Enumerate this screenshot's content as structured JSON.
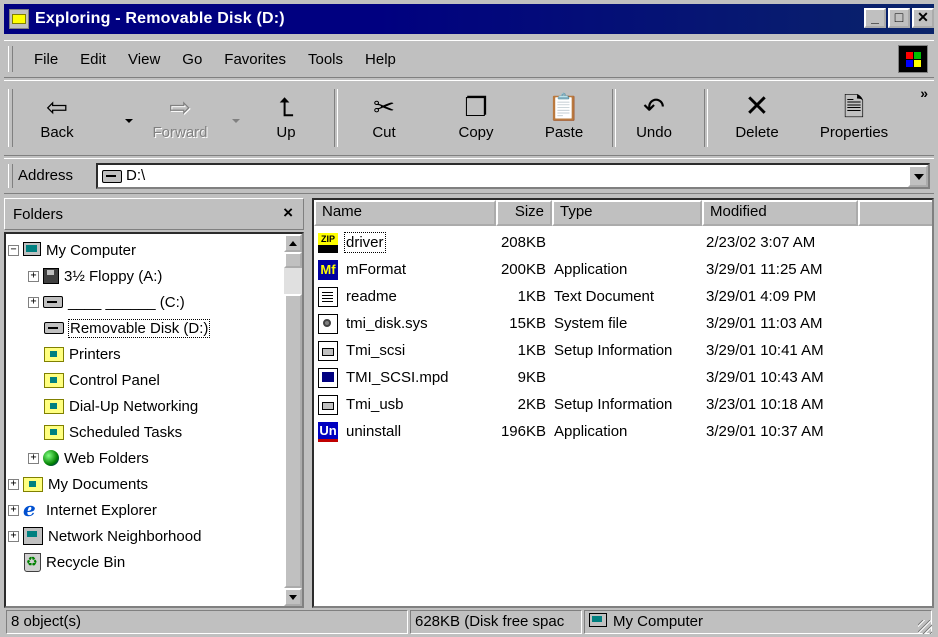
{
  "window": {
    "title": "Exploring - Removable Disk (D:)",
    "buttons": {
      "minimize": "_",
      "maximize": "□",
      "close": "✕"
    }
  },
  "menubar": {
    "items": [
      {
        "label": "File"
      },
      {
        "label": "Edit"
      },
      {
        "label": "View"
      },
      {
        "label": "Go"
      },
      {
        "label": "Favorites"
      },
      {
        "label": "Tools"
      },
      {
        "label": "Help"
      }
    ]
  },
  "toolbar": {
    "back": {
      "label": "Back",
      "icon": "back-arrow-icon"
    },
    "forward": {
      "label": "Forward",
      "icon": "forward-arrow-icon",
      "disabled": true
    },
    "up": {
      "label": "Up",
      "icon": "up-folder-icon"
    },
    "cut": {
      "label": "Cut",
      "icon": "scissors-icon"
    },
    "copy": {
      "label": "Copy",
      "icon": "copy-icon"
    },
    "paste": {
      "label": "Paste",
      "icon": "paste-icon"
    },
    "undo": {
      "label": "Undo",
      "icon": "undo-icon"
    },
    "delete": {
      "label": "Delete",
      "icon": "delete-x-icon"
    },
    "properties": {
      "label": "Properties",
      "icon": "properties-icon"
    },
    "more": "»"
  },
  "address": {
    "label": "Address",
    "value": "D:\\"
  },
  "folders_pane": {
    "title": "Folders",
    "close": "×",
    "tree": [
      {
        "label": "My Computer",
        "expander": "−",
        "icon": "computer-icon"
      },
      {
        "label": "3½ Floppy (A:)",
        "expander": "+",
        "icon": "floppy-icon"
      },
      {
        "label": "____ ______ (C:)",
        "expander": "+",
        "icon": "drive-icon"
      },
      {
        "label": "Removable Disk (D:)",
        "expander": "",
        "icon": "drive-icon",
        "selected": true
      },
      {
        "label": "Printers",
        "expander": "",
        "icon": "printers-folder-icon"
      },
      {
        "label": "Control Panel",
        "expander": "",
        "icon": "control-panel-icon"
      },
      {
        "label": "Dial-Up Networking",
        "expander": "",
        "icon": "dialup-folder-icon"
      },
      {
        "label": "Scheduled Tasks",
        "expander": "",
        "icon": "scheduled-tasks-icon"
      },
      {
        "label": "Web Folders",
        "expander": "+",
        "icon": "web-folders-icon"
      },
      {
        "label": "My Documents",
        "expander": "+",
        "icon": "my-documents-icon"
      },
      {
        "label": "Internet Explorer",
        "expander": "+",
        "icon": "internet-explorer-icon"
      },
      {
        "label": "Network Neighborhood",
        "expander": "+",
        "icon": "network-icon"
      },
      {
        "label": "Recycle Bin",
        "expander": "",
        "icon": "recycle-bin-icon"
      }
    ]
  },
  "file_list": {
    "columns": {
      "name": "Name",
      "size": "Size",
      "type": "Type",
      "modified": "Modified"
    },
    "rows": [
      {
        "name": "driver",
        "size": "208KB",
        "type": "",
        "modified": "2/23/02 3:07 AM",
        "icon": "zip-icon",
        "focused": true
      },
      {
        "name": "mFormat",
        "size": "200KB",
        "type": "Application",
        "modified": "3/29/01 11:25 AM",
        "icon": "mformat-app-icon"
      },
      {
        "name": "readme",
        "size": "1KB",
        "type": "Text Document",
        "modified": "3/29/01 4:09 PM",
        "icon": "text-document-icon"
      },
      {
        "name": "tmi_disk.sys",
        "size": "15KB",
        "type": "System file",
        "modified": "3/29/01 11:03 AM",
        "icon": "system-file-icon"
      },
      {
        "name": "Tmi_scsi",
        "size": "1KB",
        "type": "Setup Information",
        "modified": "3/29/01 10:41 AM",
        "icon": "setup-info-icon"
      },
      {
        "name": "TMI_SCSI.mpd",
        "size": "9KB",
        "type": "",
        "modified": "3/29/01 10:43 AM",
        "icon": "mpd-file-icon"
      },
      {
        "name": "Tmi_usb",
        "size": "2KB",
        "type": "Setup Information",
        "modified": "3/23/01 10:18 AM",
        "icon": "setup-info-icon"
      },
      {
        "name": "uninstall",
        "size": "196KB",
        "type": "Application",
        "modified": "3/29/01 10:37 AM",
        "icon": "uninstall-app-icon"
      }
    ]
  },
  "statusbar": {
    "objects": "8 object(s)",
    "free_space": "628KB (Disk free spac",
    "zone": "My Computer"
  },
  "colors": {
    "title_active": "#000080",
    "face": "#c0c0c0",
    "window_bg": "#ffffff"
  }
}
